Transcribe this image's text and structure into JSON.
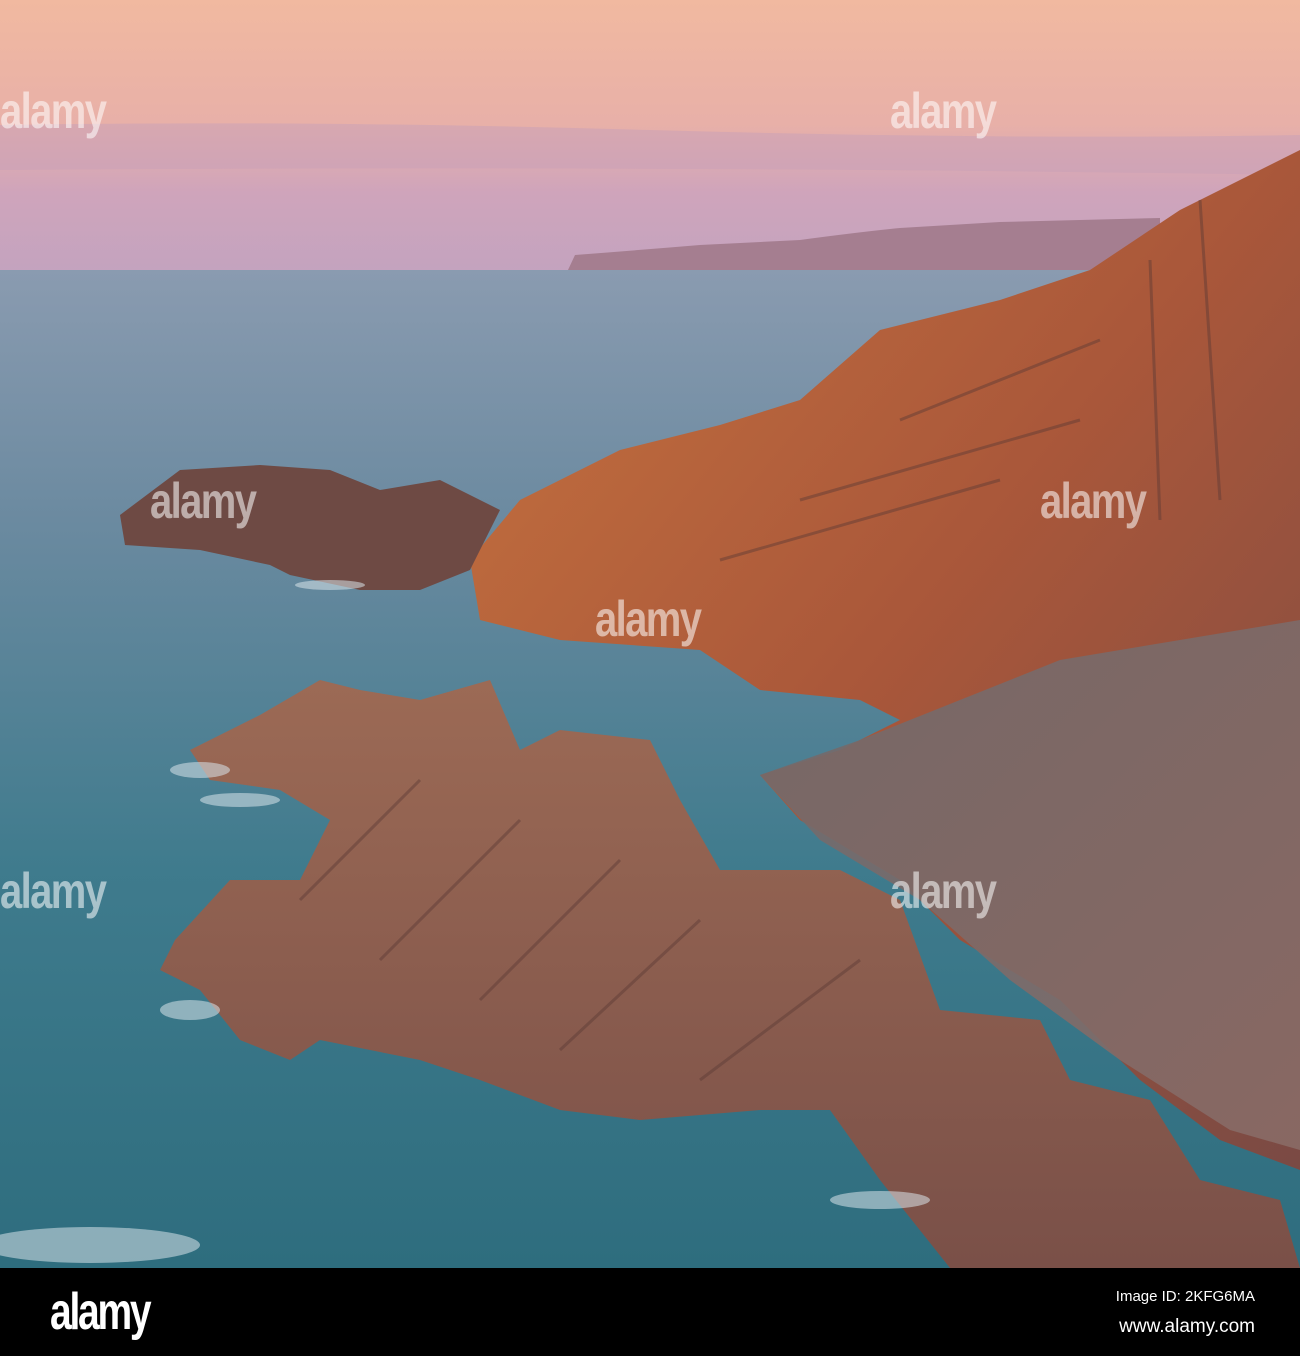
{
  "photo": {
    "subject": "Rocky coastal cliffs at sunset above the sea",
    "colors": {
      "sky_top": "#f1b9a0",
      "sky_bottom": "#c9a3bb",
      "sea": "#3d7688",
      "cliff": "#b8603a"
    }
  },
  "watermark": {
    "text": "alamy"
  },
  "footer": {
    "logo": "alamy",
    "image_id": "Image ID: 2KFG6MA",
    "url": "www.alamy.com"
  }
}
